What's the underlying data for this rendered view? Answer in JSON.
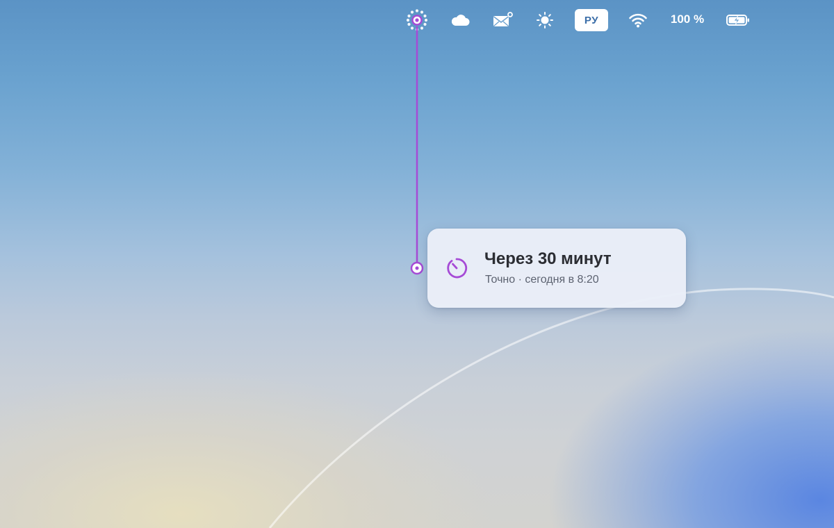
{
  "menubar": {
    "icons": {
      "activity": "activity-ring-icon",
      "cloud": "cloud-icon",
      "mail": "mail-icon",
      "brightness": "brightness-icon",
      "wifi": "wifi-icon",
      "battery": "battery-charging-icon"
    },
    "language": "РУ",
    "battery_percent": "100 %"
  },
  "notification": {
    "icon": "timer-icon",
    "title": "Через 30 минут",
    "subtitle": "Точно · сегодня в 8:20",
    "accent_color": "#a64bd6"
  }
}
